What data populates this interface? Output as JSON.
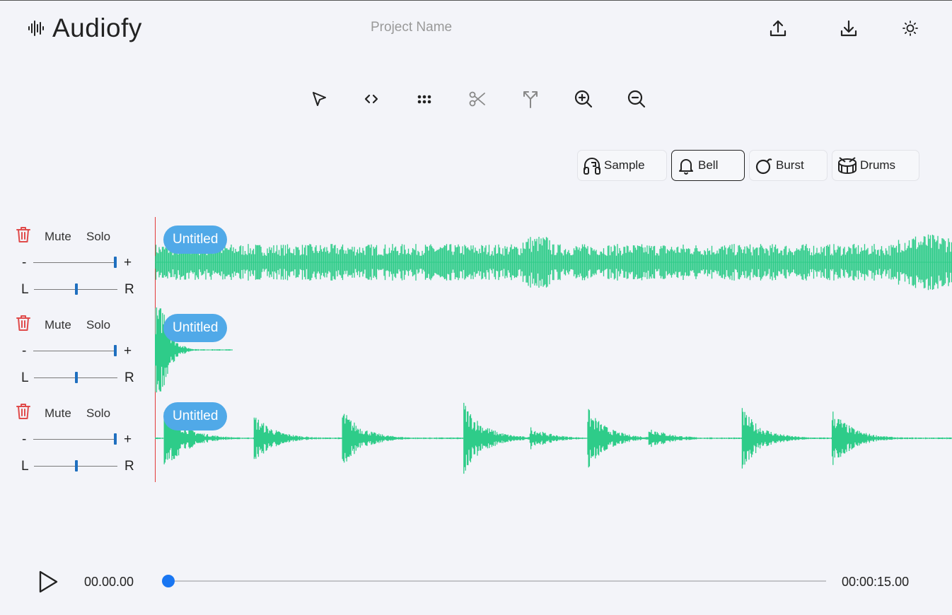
{
  "app": {
    "title": "Audiofy",
    "project_name_placeholder": "Project Name"
  },
  "header_icons": [
    "waveform-logo-icon",
    "upload-icon",
    "download-icon",
    "sun-icon"
  ],
  "toolbar": [
    "pointer-icon",
    "code-icon",
    "dots-grid-icon",
    "scissors-icon",
    "split-arrows-icon",
    "zoom-in-icon",
    "zoom-out-icon"
  ],
  "instruments": [
    {
      "label": "Sample",
      "icon": "headphones-icon",
      "active": false
    },
    {
      "label": "Bell",
      "icon": "bell-icon",
      "active": true
    },
    {
      "label": "Burst",
      "icon": "bomb-icon",
      "active": false
    },
    {
      "label": "Drums",
      "icon": "drum-icon",
      "active": false
    }
  ],
  "tracks": [
    {
      "mute": "Mute",
      "solo": "Solo",
      "vol_minus": "-",
      "vol_plus": "+",
      "pan_left": "L",
      "pan_right": "R",
      "volume": 1.0,
      "pan": 0.5,
      "clip_name": "Untitled"
    },
    {
      "mute": "Mute",
      "solo": "Solo",
      "vol_minus": "-",
      "vol_plus": "+",
      "pan_left": "L",
      "pan_right": "R",
      "volume": 1.0,
      "pan": 0.5,
      "clip_name": "Untitled"
    },
    {
      "mute": "Mute",
      "solo": "Solo",
      "vol_minus": "-",
      "vol_plus": "+",
      "pan_left": "L",
      "pan_right": "R",
      "volume": 1.0,
      "pan": 0.5,
      "clip_name": "Untitled"
    }
  ],
  "transport": {
    "current_time": "00.00.00",
    "total_time": "00:00:15.00",
    "progress": 0.0
  },
  "colors": {
    "waveform": "#2ecc89",
    "clip_label": "#50a9e8",
    "playhead": "#e23a3a",
    "progress_dot": "#1976f2",
    "trash": "#e04b4b"
  }
}
